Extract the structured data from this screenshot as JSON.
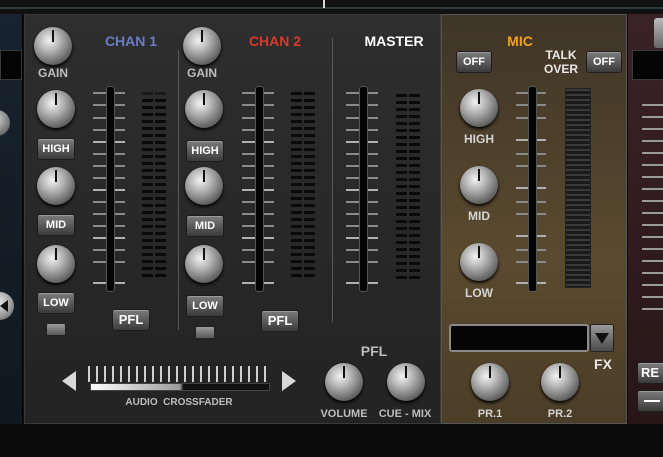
{
  "colors": {
    "chan1": "#6b7dc4",
    "chan2": "#d83a2a",
    "master": "#ffffff",
    "mic": "#f0a020",
    "label": "#bdbdbd"
  },
  "chan1": {
    "title": "CHAN 1",
    "gain_label": "GAIN",
    "high_label": "HIGH",
    "mid_label": "MID",
    "low_label": "LOW",
    "pfl_label": "PFL"
  },
  "chan2": {
    "title": "CHAN 2",
    "gain_label": "GAIN",
    "high_label": "HIGH",
    "mid_label": "MID",
    "low_label": "LOW",
    "pfl_label": "PFL"
  },
  "master": {
    "title": "MASTER"
  },
  "crossfader": {
    "label": "AUDIO  CROSSFADER"
  },
  "pfl": {
    "title": "PFL",
    "volume_label": "VOLUME",
    "cue_mix_label": "CUE - MIX"
  },
  "mic": {
    "title": "MIC",
    "off_label": "OFF",
    "talkover_line1": "TALK",
    "talkover_line2": "OVER",
    "talkover_off_label": "OFF",
    "high_label": "HIGH",
    "mid_label": "MID",
    "low_label": "LOW",
    "fx_label": "FX",
    "fx_value": "",
    "pr1_label": "PR.1",
    "pr2_label": "PR.2"
  },
  "right_deck": {
    "button_label": "RE"
  }
}
